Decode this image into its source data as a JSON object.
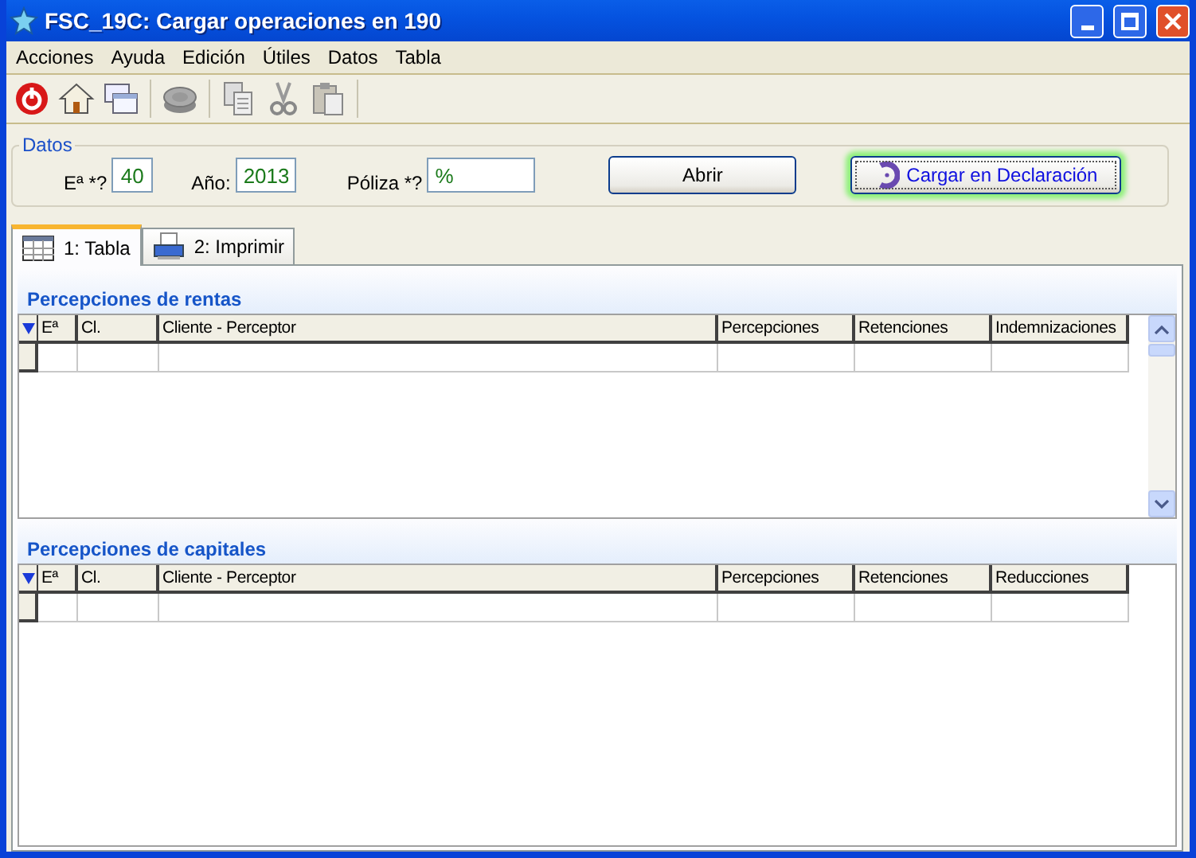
{
  "window": {
    "title": "FSC_19C: Cargar operaciones en 190"
  },
  "menu": [
    "Acciones",
    "Ayuda",
    "Edición",
    "Útiles",
    "Datos",
    "Tabla"
  ],
  "datos": {
    "legend": "Datos",
    "fields": [
      {
        "label": "Eª *?",
        "value": "40",
        "kind": "short"
      },
      {
        "label": "Año:",
        "value": "2013",
        "kind": "medium"
      },
      {
        "label": "Póliza *?",
        "value": "%",
        "kind": "wide"
      }
    ],
    "buttons": [
      {
        "label": "Abrir",
        "focused": false,
        "kind": "plain"
      },
      {
        "label": "Cargar en Declaración",
        "focused": true,
        "kind": "load"
      }
    ]
  },
  "tabs": [
    {
      "label": "1: Tabla",
      "selected": true,
      "kind": "table"
    },
    {
      "label": "2: Imprimir",
      "selected": false,
      "kind": "printer"
    }
  ],
  "sections": [
    {
      "title": "Percepciones de rentas",
      "scrollbar": true,
      "columns": [
        "Eª",
        "Cl.",
        "Cliente - Perceptor",
        "Percepciones",
        "Retenciones",
        "Indemnizaciones"
      ]
    },
    {
      "title": "Percepciones de capitales",
      "scrollbar": false,
      "columns": [
        "Eª",
        "Cl.",
        "Cliente - Perceptor",
        "Percepciones",
        "Retenciones",
        "Reducciones"
      ]
    }
  ]
}
